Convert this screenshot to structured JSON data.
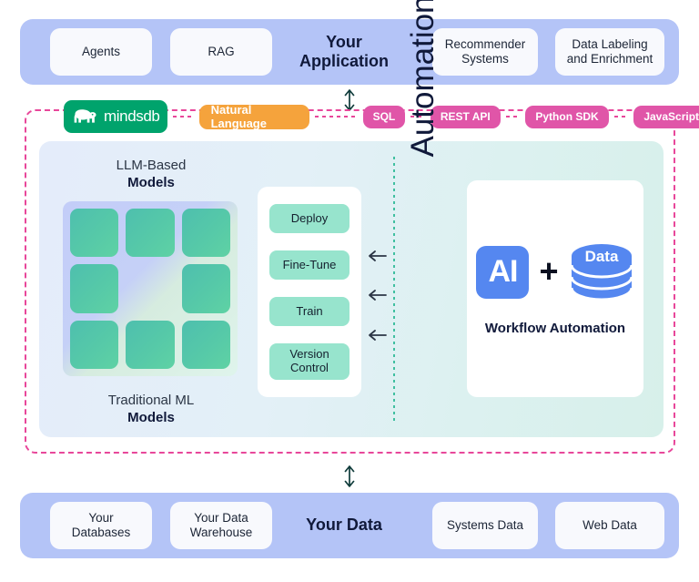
{
  "top_band": {
    "title": "Your\nApplication",
    "title_line1": "Your",
    "title_line2": "Application",
    "left_chips": [
      {
        "label": "Agents"
      },
      {
        "label": "RAG"
      }
    ],
    "right_chips": [
      {
        "label": "Recommender\nSystems",
        "line1": "Recommender",
        "line2": "Systems"
      },
      {
        "label": "Data Labeling\nand Enrichment",
        "line1": "Data Labeling",
        "line2": "and Enrichment"
      }
    ]
  },
  "bottom_band": {
    "title": "Your Data",
    "left_chips": [
      {
        "label": "Your\nDatabases",
        "line1": "Your",
        "line2": "Databases"
      },
      {
        "label": "Your Data\nWarehouse",
        "line1": "Your Data",
        "line2": "Warehouse"
      }
    ],
    "right_chips": [
      {
        "label": "Systems Data"
      },
      {
        "label": "Web Data"
      }
    ]
  },
  "connectors": {
    "top_arrow": "double-arrow-vertical",
    "bottom_arrow": "double-arrow-vertical"
  },
  "interface_row": {
    "brand": "mindsdb",
    "brand_icon": "elephant-icon",
    "natural_language_badge": "Natural Language",
    "api_badges": [
      {
        "label": "SQL"
      },
      {
        "label": "REST API"
      },
      {
        "label": "Python SDK"
      },
      {
        "label": "JavaScript SDK"
      }
    ]
  },
  "panel": {
    "llm_label_line1": "LLM-Based",
    "llm_label_line2": "Models",
    "traditional_label_line1": "Traditional ML",
    "traditional_label_line2": "Models",
    "model_grid": {
      "rows": 3,
      "cols": 3,
      "filled_cells": [
        1,
        1,
        1,
        1,
        0,
        1,
        1,
        1,
        1
      ]
    },
    "ops_card": {
      "items": [
        {
          "label": "Deploy"
        },
        {
          "label": "Fine-Tune"
        },
        {
          "label": "Train"
        },
        {
          "label": "Version\nControl",
          "line1": "Version",
          "line2": "Control"
        }
      ]
    },
    "flow_arrows": [
      "arrow-left-icon",
      "arrow-left-icon",
      "arrow-left-icon"
    ],
    "automation_label": "Automation",
    "workflow_card": {
      "ai_label": "AI",
      "plus": "+",
      "data_label": "Data",
      "caption": "Workflow Automation",
      "database_icon": "database-cylinder-icon"
    }
  },
  "colors": {
    "band_background": "#b4c4f7",
    "chip_background": "#f8f9fd",
    "brand_green": "#00a36c",
    "natural_language_orange": "#f5a33c",
    "api_pink": "#e055a8",
    "dashed_border_pink": "#e8479a",
    "ops_pill_mint": "#97e4cd",
    "model_tile_teal": "#4ebfae",
    "ai_blue": "#5587f0",
    "divider_teal": "#3fbfa0",
    "text_dark": "#10193a"
  }
}
